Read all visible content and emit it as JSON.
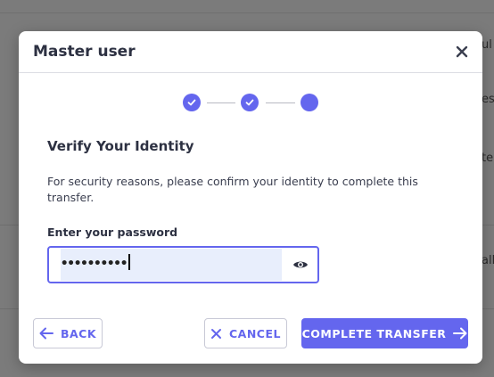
{
  "background": {
    "fragments": [
      "ul",
      "ess",
      "ter",
      "all"
    ]
  },
  "modal": {
    "title": "Master user",
    "stepper": {
      "total_steps": 3,
      "completed_steps": 2,
      "current_step": 3
    },
    "heading": "Verify Your Identity",
    "description": "For security reasons, please confirm your identity to complete this transfer.",
    "password": {
      "label": "Enter your password",
      "value": "••••••••••"
    },
    "buttons": {
      "back": "BACK",
      "cancel": "CANCEL",
      "complete": "COMPLETE TRANSFER"
    }
  },
  "colors": {
    "accent": "#6466ee",
    "text_dark": "#2d3142",
    "input_fill": "#e8eefc"
  }
}
